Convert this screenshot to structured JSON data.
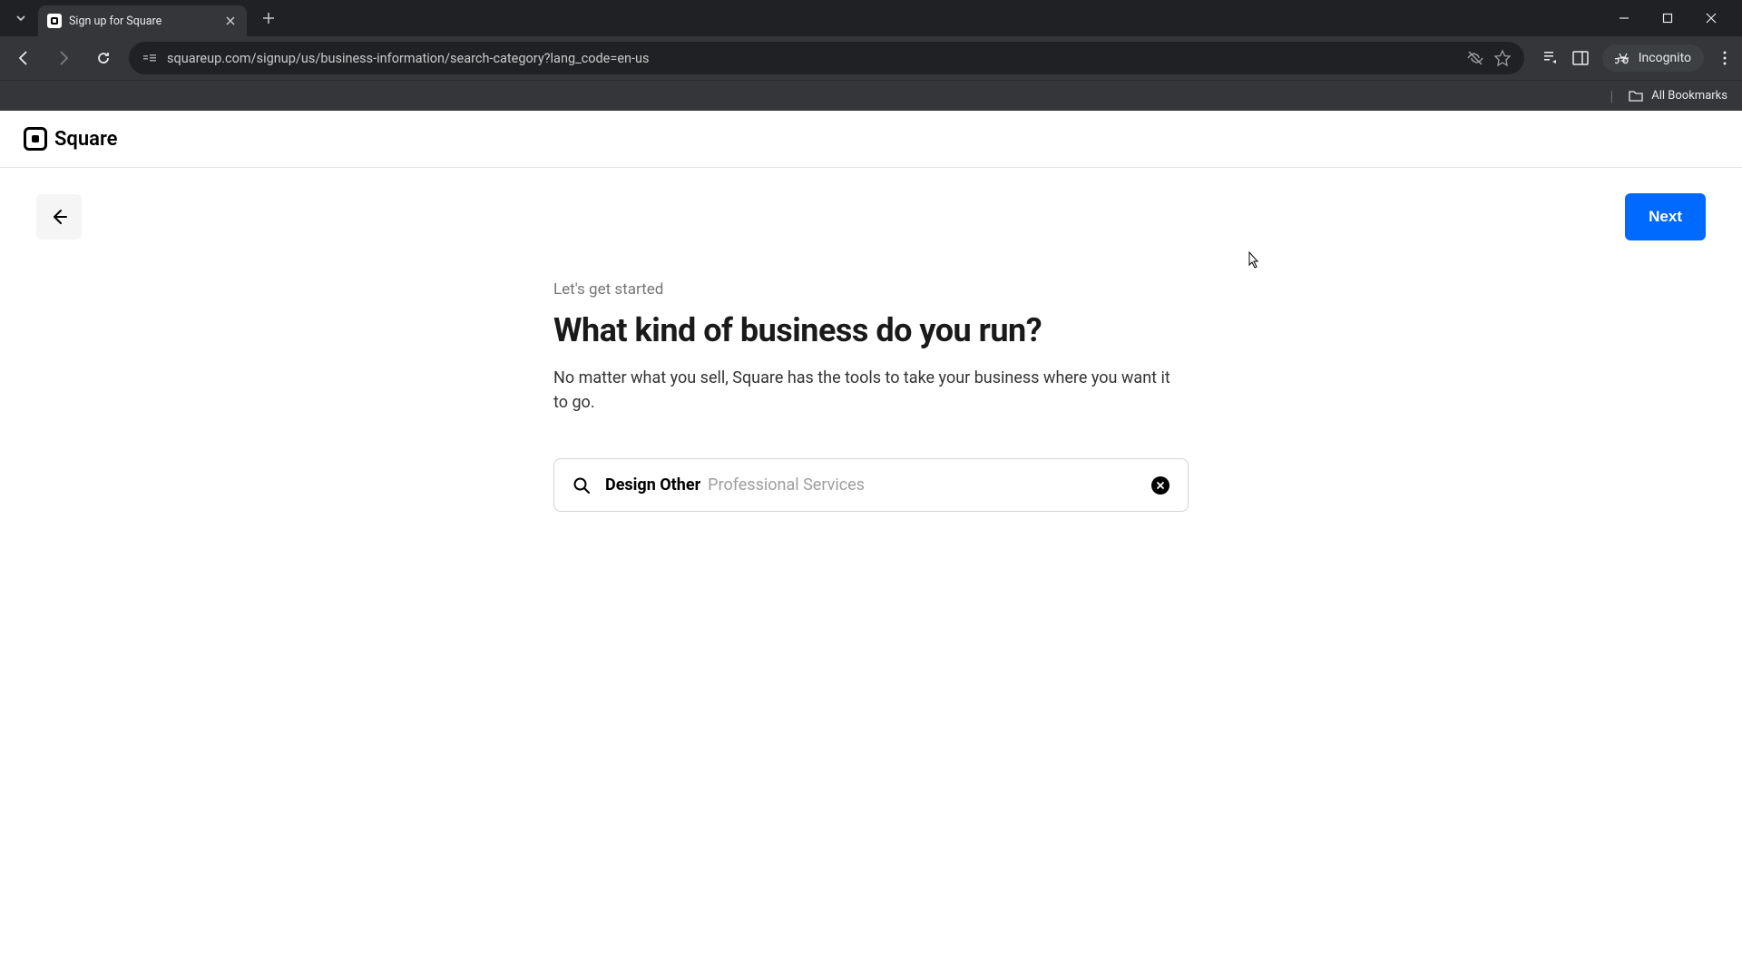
{
  "browser": {
    "tab_title": "Sign up for Square",
    "url": "squareup.com/signup/us/business-information/search-category?lang_code=en-us",
    "incognito_label": "Incognito",
    "all_bookmarks_label": "All Bookmarks"
  },
  "header": {
    "brand": "Square"
  },
  "nav": {
    "next_label": "Next"
  },
  "main": {
    "eyebrow": "Let's get started",
    "heading": "What kind of business do you run?",
    "subtext": "No matter what you sell, Square has the tools to take your business where you want it to go.",
    "search_value": "Design Other",
    "search_category": "Professional Services"
  }
}
